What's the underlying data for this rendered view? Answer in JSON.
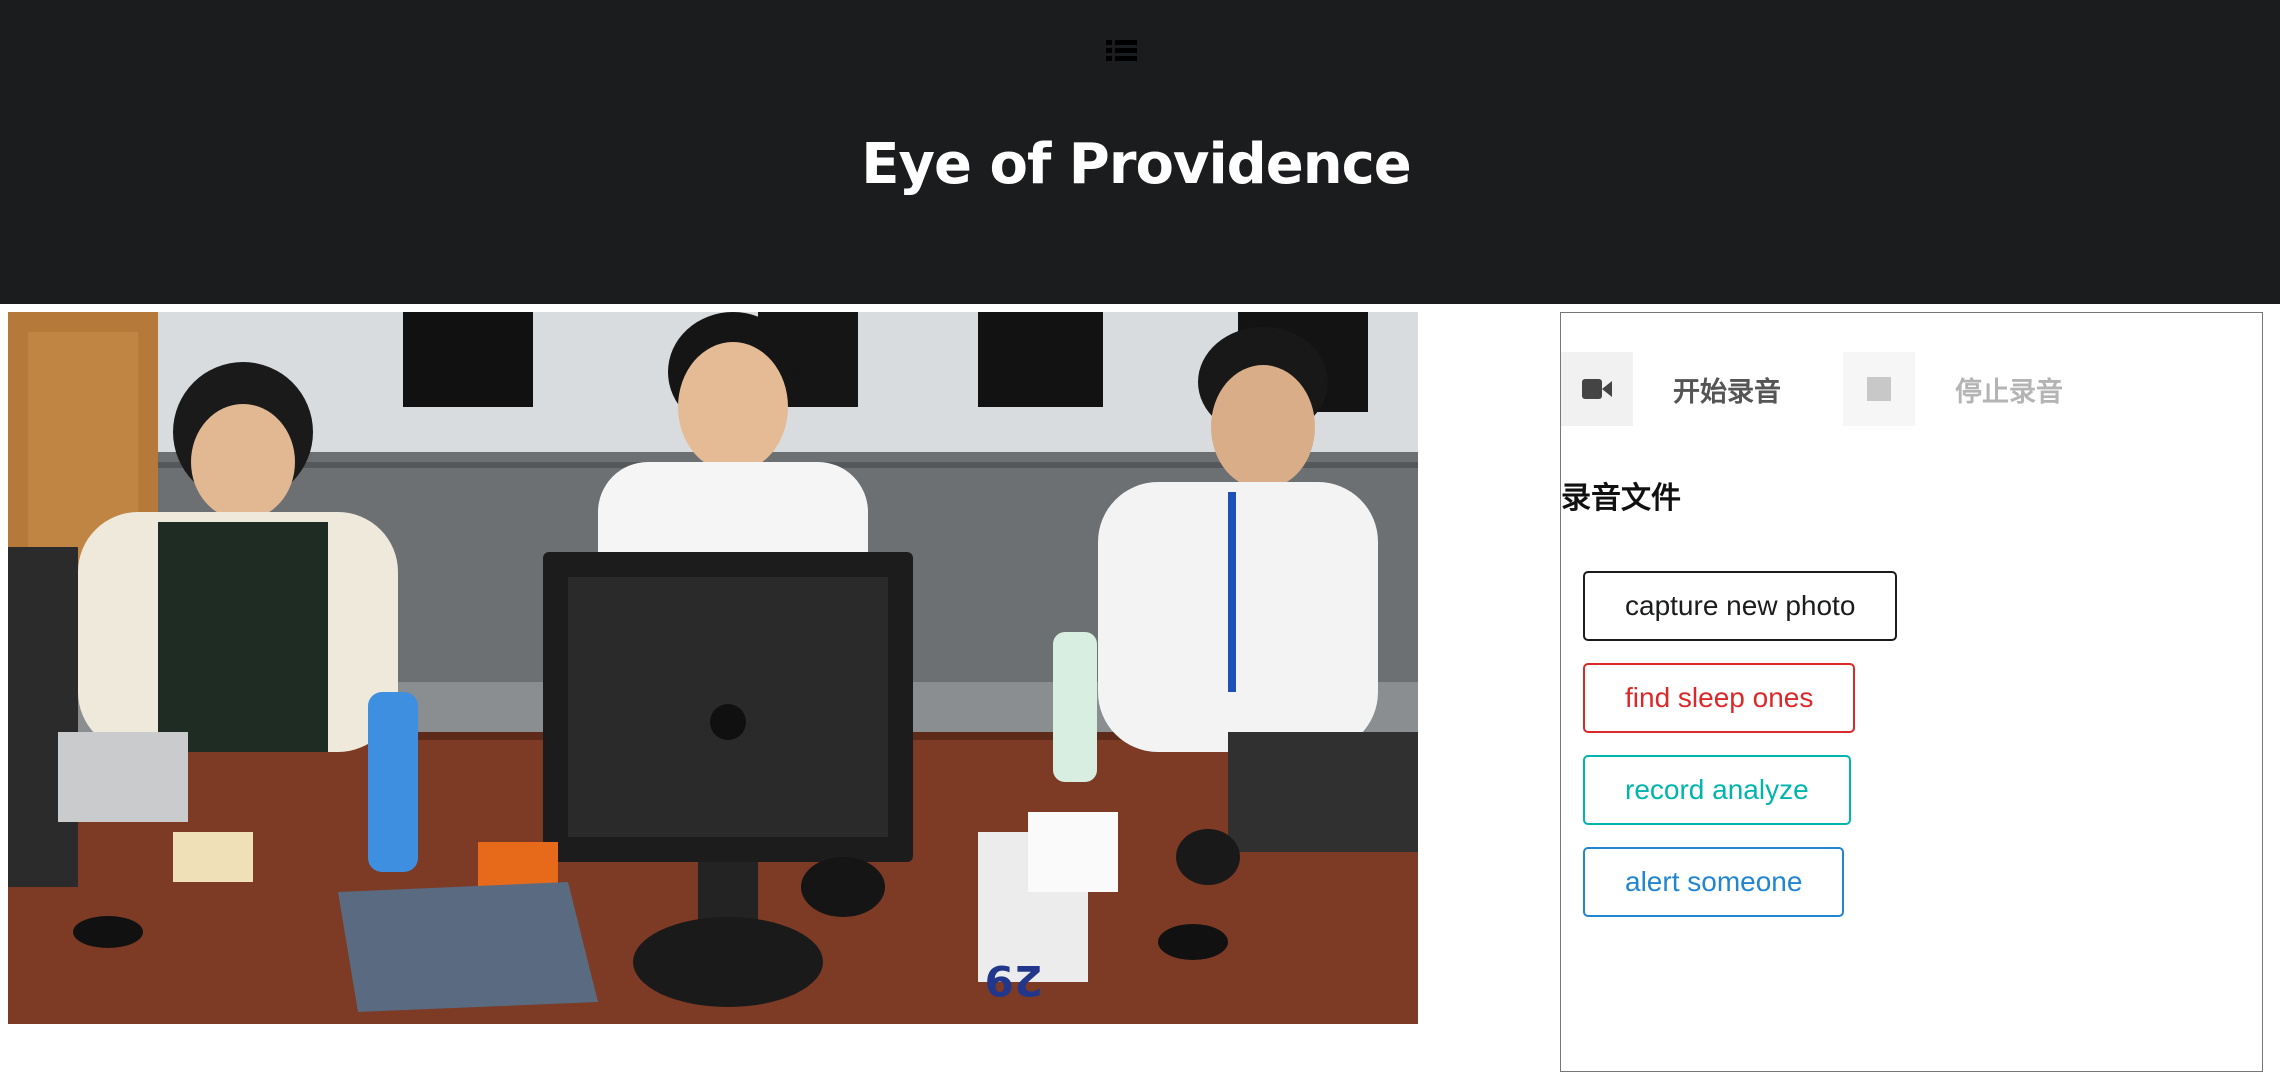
{
  "header": {
    "menu_icon": "list-icon",
    "title": "Eye of Providence"
  },
  "photo": {
    "description_icon": "classroom-photo"
  },
  "recorder": {
    "start_icon": "video-camera-icon",
    "start_label": "开始录音",
    "stop_icon": "stop-square-icon",
    "stop_label": "停止录音"
  },
  "files": {
    "heading": "录音文件"
  },
  "actions": {
    "capture_label": "capture new photo",
    "sleep_label": "find sleep ones",
    "analyze_label": "record analyze",
    "alert_label": "alert someone"
  },
  "colors": {
    "header_bg": "#1b1c1d",
    "black": "#1b1c1d",
    "red": "#db2828",
    "teal": "#00b5ad",
    "blue": "#2185d0"
  }
}
